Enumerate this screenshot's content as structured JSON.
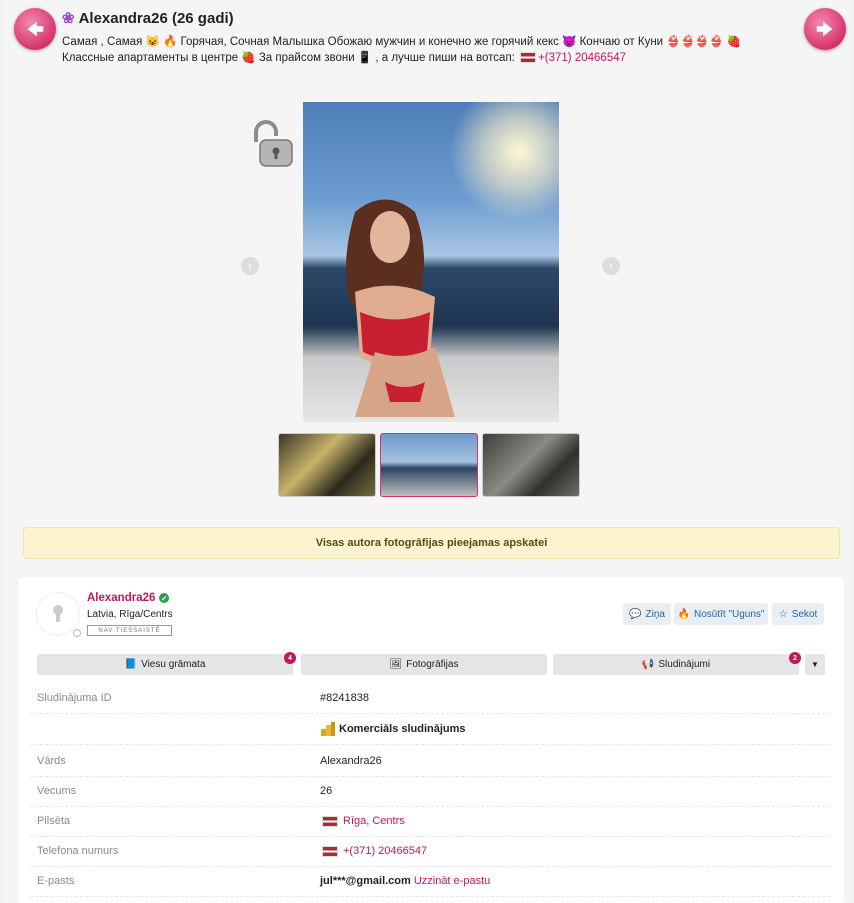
{
  "header": {
    "title": "Alexandra26 (26 gadi)",
    "description": "Самая , Самая 😺 🔥 Горячая, Сочная Малышка Обожаю мужчин и конечно же горячий кекс 😈 Кончаю от Куни 👙👙👙👙 🍓 Классные апартаменты в центре 🍓 За прайсом звони 📱 , а лучше пиши на вотсап:",
    "phone": "+(371) 20466547"
  },
  "notice": "Visas autora fotogrāfijas pieejamas apskatei",
  "profile": {
    "username": "Alexandra26",
    "location": "Latvia, Rīga/Centrs",
    "status": "NAV TIEŠSAISTĒ"
  },
  "actions": {
    "message": "Ziņa",
    "fire": "Nosūtīt \"Uguns\"",
    "follow": "Sekot"
  },
  "tabs": [
    {
      "label": "Viesu grāmata",
      "badge": "4"
    },
    {
      "label": "Fotogrāfijas",
      "badge": ""
    },
    {
      "label": "Sludinājumi",
      "badge": "2"
    }
  ],
  "details": [
    {
      "key": "Sludinājuma ID",
      "value": "#8241838"
    },
    {
      "key": "",
      "value": "Komerciāls sludinājums"
    },
    {
      "key": "Vārds",
      "value": "Alexandra26"
    },
    {
      "key": "Vecums",
      "value": "26"
    },
    {
      "key": "Pilsēta",
      "value": "Rīga, Centrs"
    },
    {
      "key": "Telefona numurs",
      "value": "+(371) 20466547"
    },
    {
      "key": "E-pasts",
      "value": "jul***@gmail.com",
      "link": "Uzzināt e-pastu"
    }
  ],
  "colors": {
    "accent": "#c2185b",
    "notice_bg": "#fcf3cf"
  }
}
